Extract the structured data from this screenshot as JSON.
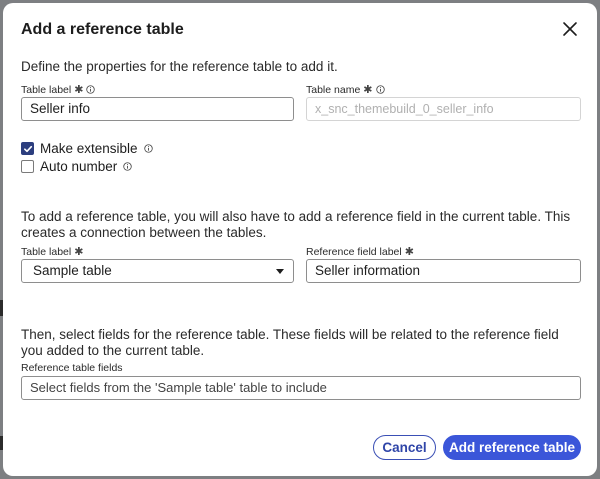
{
  "dialog": {
    "title": "Add a reference table",
    "description": "Define the properties for the reference table to add it."
  },
  "table_label": {
    "label": "Table label",
    "value": "Seller info"
  },
  "table_name": {
    "label": "Table name",
    "value": "x_snc_themebuild_0_seller_info"
  },
  "checkboxes": {
    "make_extensible": {
      "label": "Make extensible",
      "checked": true
    },
    "auto_number": {
      "label": "Auto number",
      "checked": false
    }
  },
  "reference_section": {
    "paragraph": "To add a reference table, you will also have to add a reference field in the current table. This creates a connection between the tables.",
    "table_label": "Table label",
    "table_select_value": "Sample table",
    "reference_field_label": "Reference field label",
    "reference_field_value": "Seller information"
  },
  "fields_section": {
    "paragraph": "Then, select fields for the reference table. These fields will be related to the reference field you added to the current table.",
    "label": "Reference table fields",
    "placeholder": "Select fields from the 'Sample table' table to include"
  },
  "buttons": {
    "cancel": "Cancel",
    "add": "Add reference table"
  },
  "colors": {
    "primary": "#3b56d9",
    "checkbox": "#2c3e7e"
  },
  "icons": {
    "close": "close-icon",
    "info": "info-icon",
    "required": "required-asterisk-icon",
    "check": "check-icon",
    "caret": "caret-down-icon"
  }
}
